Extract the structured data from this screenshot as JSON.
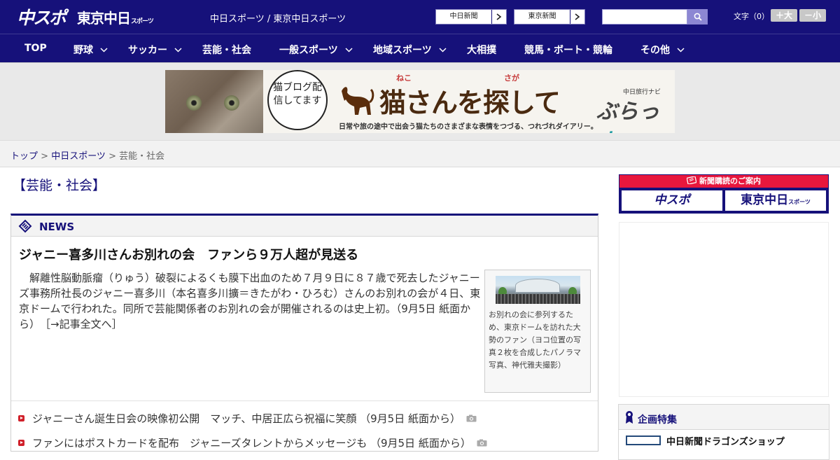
{
  "header": {
    "logo_chuspo": "中スポ",
    "logo_tokyo": "東京中日",
    "logo_tokyo_sub": "スポーツ",
    "site_links": "中日スポーツ / 東京中日スポーツ",
    "ext_links": [
      {
        "label": "中日新聞"
      },
      {
        "label": "東京新聞"
      }
    ],
    "search": {
      "placeholder": ""
    },
    "font_size_label": "文字（0）",
    "font_larger": "＋大",
    "font_smaller": "－小"
  },
  "nav": {
    "items": [
      {
        "label": "TOP",
        "dropdown": false
      },
      {
        "label": "野球",
        "dropdown": true
      },
      {
        "label": "サッカー",
        "dropdown": true
      },
      {
        "label": "芸能・社会",
        "dropdown": false
      },
      {
        "label": "一般スポーツ",
        "dropdown": true
      },
      {
        "label": "地域スポーツ",
        "dropdown": true
      },
      {
        "label": "大相撲",
        "dropdown": false
      },
      {
        "label": "競馬・ボート・競輪",
        "dropdown": false
      },
      {
        "label": "その他",
        "dropdown": true
      }
    ]
  },
  "banner": {
    "bubble_text": "猫ブログ配信してます",
    "title": "猫さんを探して",
    "ruby_neko": "ねこ",
    "ruby_saga": "さが",
    "subtitle": "日常や旅の途中で出会う猫たちのさまざまな表情をつづる、つれづれダイアリー。",
    "brand_small": "中日旅行ナビ",
    "brand_big_1": "ぶらっ",
    "brand_big_2": "人"
  },
  "breadcrumb": {
    "top": "トップ",
    "sep1": " > ",
    "section": "中日スポーツ",
    "sep2": " > ",
    "current": "芸能・社会"
  },
  "main": {
    "page_heading": "【芸能・社会】",
    "news_label": "NEWS",
    "headline": "ジャニー喜多川さんお別れの会　ファンら９万人超が見送る",
    "lead": "解離性脳動脈瘤（りゅう）破裂によるくも膜下出血のため７月９日に８７歳で死去したジャニーズ事務所社長のジャニー喜多川（本名喜多川擴＝きたがわ・ひろむ）さんのお別れの会が４日、東京ドームで行われた。同所で芸能関係者のお別れの会が開催されるのは史上初。（9月5日 紙面から）",
    "more_link": "［→記事全文へ］",
    "photo_caption": "お別れの会に参列するため、東京ドームを訪れた大勢のファン（ヨコ位置の写真２枚を合成したパノラマ写真、神代雅夫撮影）",
    "related": [
      {
        "text": "ジャニーさん誕生日会の映像初公開　マッチ、中居正広ら祝福に笑顔 （9月5日 紙面から）"
      },
      {
        "text": "ファンにはポストカードを配布　ジャニーズタレントからメッセージも （9月5日 紙面から）"
      }
    ]
  },
  "sidebar": {
    "subscription_head": "新聞購読のご案内",
    "sub_buttons": [
      {
        "label": "中スポ",
        "sub": ""
      },
      {
        "label": "東京中日",
        "sub": "スポーツ"
      }
    ],
    "feature_title": "企画特集",
    "feature_link": "中日新聞ドラゴンズショップ"
  },
  "colors": {
    "navy": "#16117a",
    "accent_red": "#e8173d",
    "bullet_red": "#d0202a",
    "search_button": "#8c87d3"
  }
}
